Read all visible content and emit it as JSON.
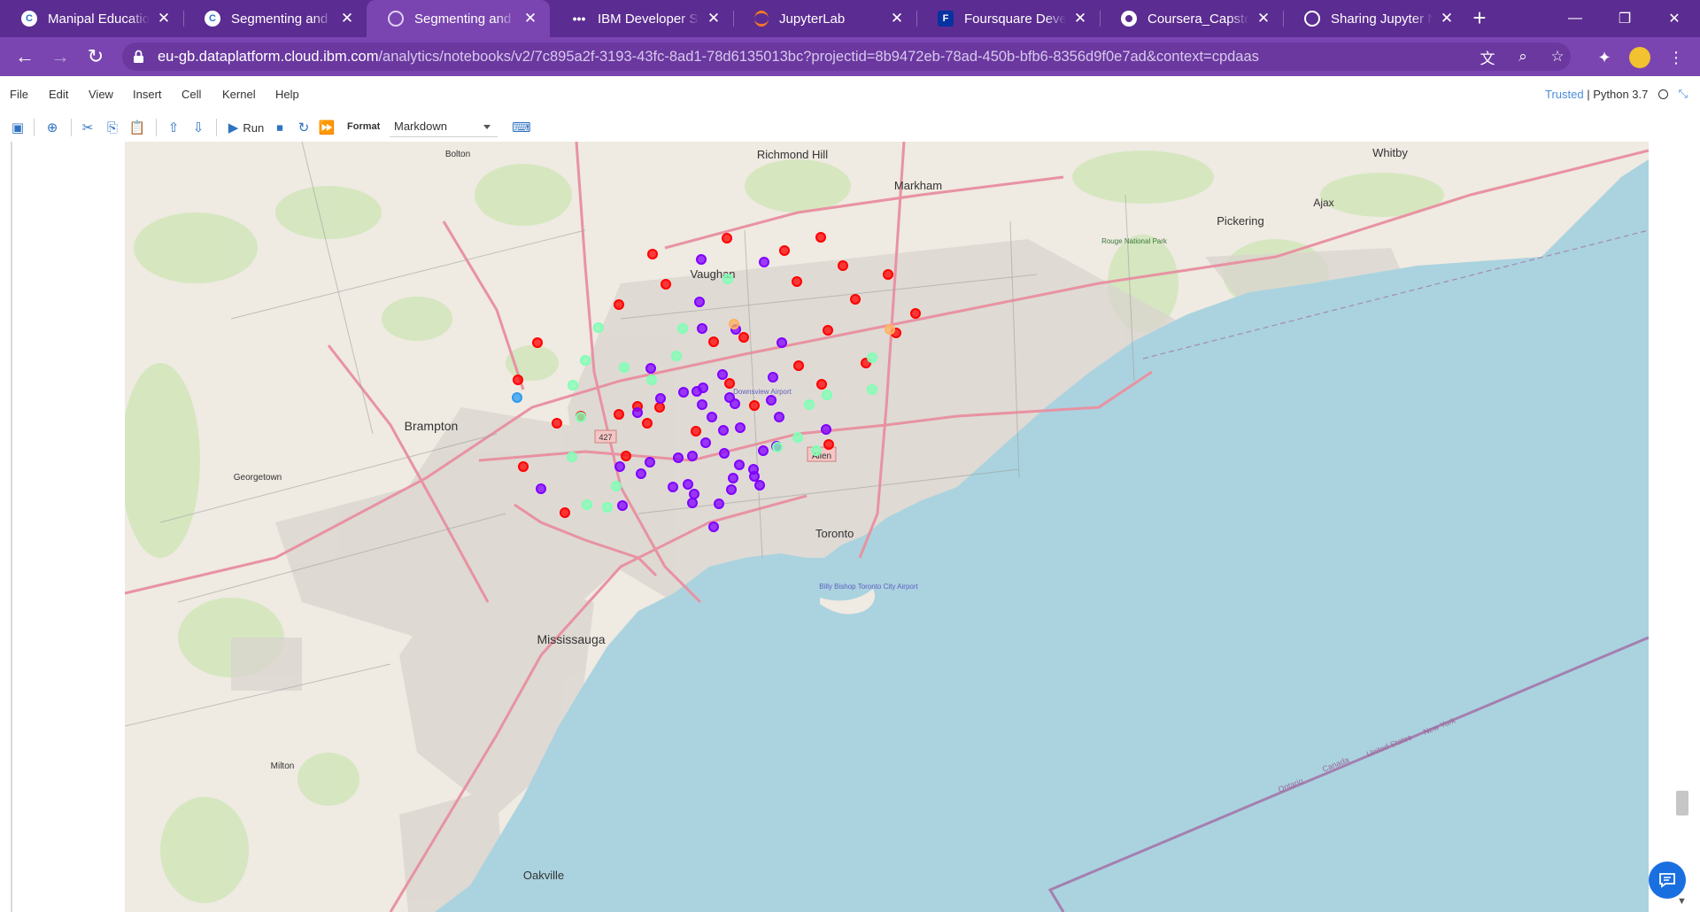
{
  "browser": {
    "tabs": [
      {
        "title": "Manipal Education",
        "favicon": "coursera-icon",
        "active": false
      },
      {
        "title": "Segmenting and Clustering",
        "favicon": "coursera-icon",
        "active": false
      },
      {
        "title": "Segmenting and Clustering",
        "favicon": "watson-studio-icon",
        "active": true
      },
      {
        "title": "IBM Developer Skills",
        "favicon": "ibm-skills-icon",
        "active": false
      },
      {
        "title": "JupyterLab",
        "favicon": "jupyter-icon",
        "active": false
      },
      {
        "title": "Foursquare Developers",
        "favicon": "foursquare-icon",
        "active": false
      },
      {
        "title": "Coursera_Capstone",
        "favicon": "github-icon",
        "active": false
      },
      {
        "title": "Sharing Jupyter Notebooks",
        "favicon": "globe-icon",
        "active": false
      }
    ],
    "url_host": "eu-gb.dataplatform.cloud.ibm.com",
    "url_path": "/analytics/notebooks/v2/7c895a2f-3193-43fc-8ad1-78d6135013bc?projectid=8b9472eb-78ad-450b-bfb6-8356d9f0e7ad&context=cpdaas",
    "theme_color": "#5b2c91"
  },
  "notebook": {
    "menu": [
      "File",
      "Edit",
      "View",
      "Insert",
      "Cell",
      "Kernel",
      "Help"
    ],
    "trusted_label": "Trusted",
    "kernel_name": "| Python 3.7",
    "run_label": "Run",
    "format_label": "Format",
    "format_value": "Markdown"
  },
  "map": {
    "water_color": "#aad3df",
    "land_color": "#efeae2",
    "place_labels": {
      "richmond_hill": "Richmond Hill",
      "markham": "Markham",
      "vaughan": "Vaughan",
      "bolton": "Bolton",
      "whitby": "Whitby",
      "ajax": "Ajax",
      "pickering": "Pickering",
      "rouge": "Rouge National Park",
      "brampton": "Brampton",
      "georgetown": "Georgetown",
      "mississauga": "Mississauga",
      "milton": "Milton",
      "oakville": "Oakville",
      "toronto": "Toronto",
      "downsview": "Downsview Airport",
      "billy_bishop": "Billy Bishop Toronto City Airport",
      "allen": "Allen",
      "hwy427": "427",
      "border_ontario": "Ontario",
      "border_canada": "Canada",
      "border_us": "United States",
      "border_ny": "New York"
    },
    "cluster_colors": {
      "red": "#ff0000",
      "purple": "#8000ff",
      "green": "#80ffb4",
      "orange": "#ffb360",
      "blue": "#2c9bf0"
    },
    "markers": [
      {
        "cluster": "red",
        "count": 33
      },
      {
        "cluster": "purple",
        "count": 46
      },
      {
        "cluster": "green",
        "count": 20
      },
      {
        "cluster": "orange",
        "count": 2
      },
      {
        "cluster": "blue",
        "count": 1
      }
    ]
  }
}
